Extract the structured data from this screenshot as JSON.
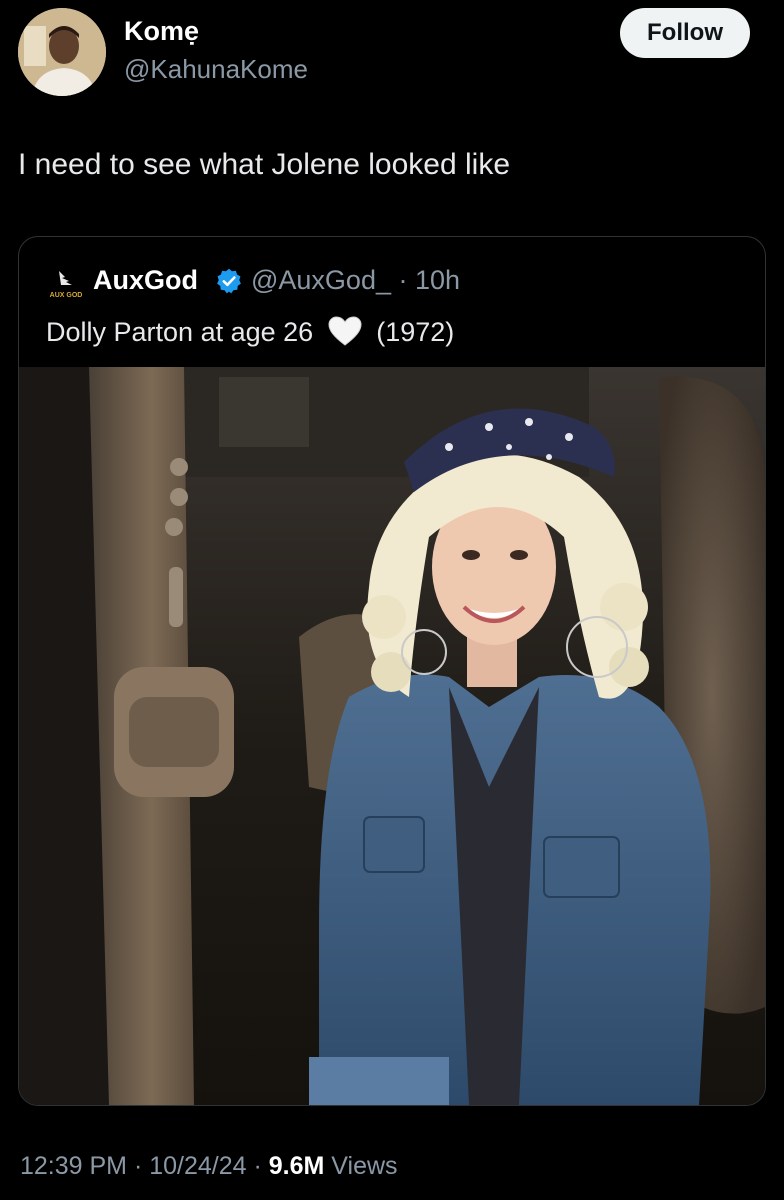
{
  "author": {
    "name": "Komẹ",
    "handle": "@KahunaKome",
    "follow_label": "Follow"
  },
  "tweet": {
    "text": "I need to see what Jolene looked like"
  },
  "quote": {
    "name": "AuxGod",
    "handle_time": "@AuxGod_ · 10h",
    "text_before": "Dolly Parton at age 26",
    "text_after": "(1972)",
    "avatar_logo_text": "AUX GOD",
    "photo_icon": "photo-of-woman-in-denim-jacket-and-bandana"
  },
  "meta": {
    "time_date": "12:39 PM · 10/24/24 · ",
    "views_count": "9.6M",
    "views_label": " Views"
  },
  "colors": {
    "background": "#000000",
    "text_primary": "#e7e9ea",
    "text_secondary": "#8b98a5",
    "follow_bg": "#eff3f4",
    "verified": "#1d9bf0",
    "border": "#2f3336"
  }
}
